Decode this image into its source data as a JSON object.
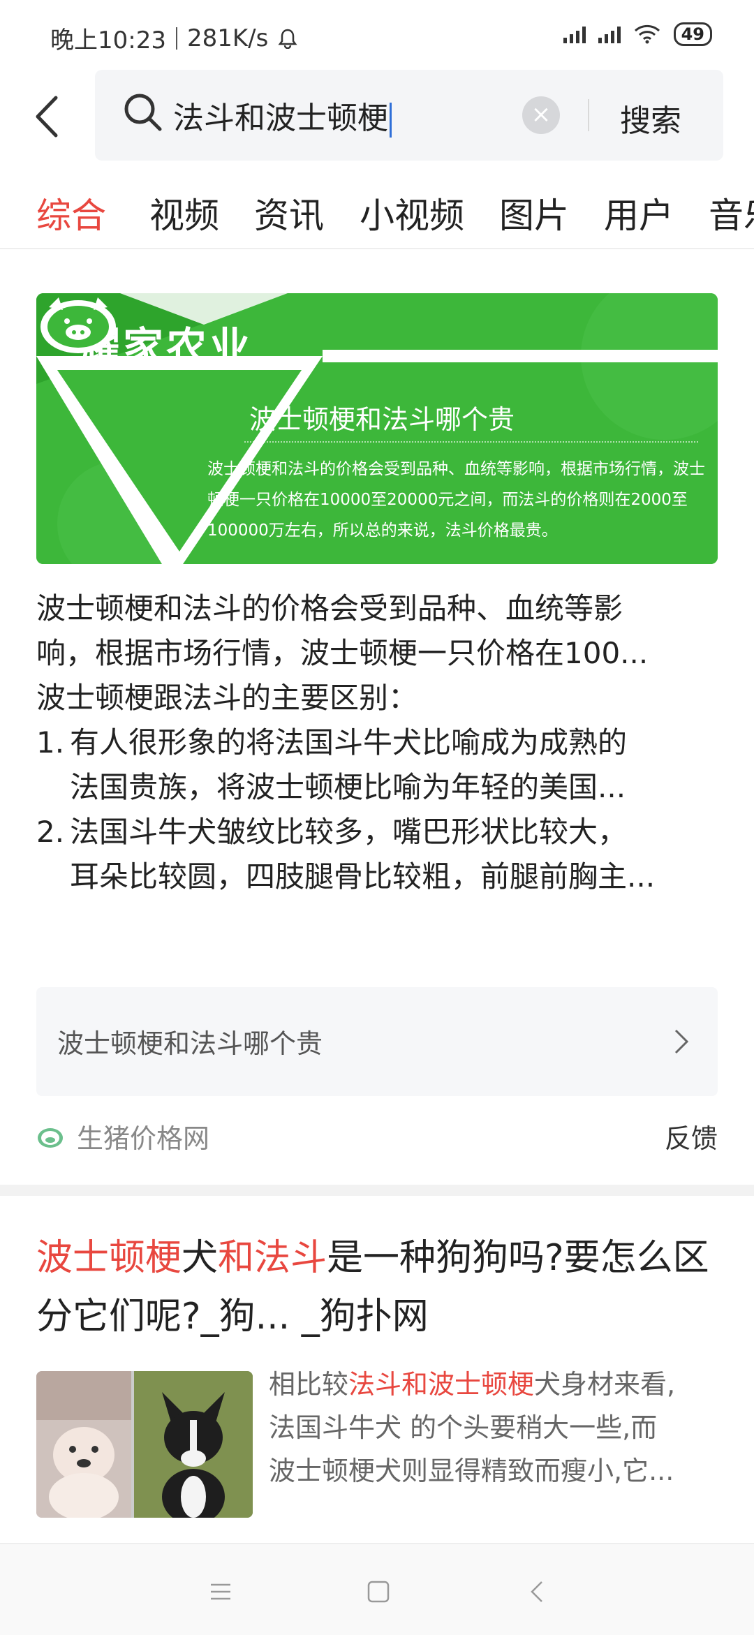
{
  "status_bar": {
    "time": "晚上10:23",
    "speed": "281K/s",
    "battery": "49",
    "icons": [
      "bell-icon",
      "signal-icon",
      "signal-icon",
      "wifi-icon",
      "battery-icon"
    ]
  },
  "search": {
    "query": "法斗和波士顿梗",
    "submit_label": "搜索",
    "clear_symbol": "×"
  },
  "tabs": [
    {
      "label": "综合",
      "active": true
    },
    {
      "label": "视频",
      "active": false
    },
    {
      "label": "资讯",
      "active": false
    },
    {
      "label": "小视频",
      "active": false
    },
    {
      "label": "图片",
      "active": false
    },
    {
      "label": "用户",
      "active": false
    },
    {
      "label": "音乐",
      "active": false
    }
  ],
  "card1": {
    "banner": {
      "brand": "耀家农业",
      "title": "波士顿梗和法斗哪个贵",
      "body": "波士顿梗和法斗的价格会受到品种、血统等影响，根据市场行情，波士顿梗一只价格在10000至20000元之间，而法斗的价格则在2000至100000万左右，所以总的来说，法斗价格最贵。"
    },
    "summary_lines": [
      "波士顿梗和法斗的价格会受到品种、血统等影",
      "响，根据市场行情，波士顿梗一只价格在100..."
    ],
    "subheading": "波士顿梗跟法斗的主要区别：",
    "points": [
      {
        "num": "1.",
        "line1": "有人很形象的将法国斗牛犬比喻成为成熟的",
        "line2": "法国贵族，将波士顿梗比喻为年轻的美国..."
      },
      {
        "num": "2.",
        "line1": "法国斗牛犬皱纹比较多，嘴巴形状比较大，",
        "line2": "耳朵比较圆，四肢腿骨比较粗，前腿前胸主..."
      }
    ],
    "related_query": "波士顿梗和法斗哪个贵",
    "source": "生猪价格网",
    "feedback": "反馈"
  },
  "card2": {
    "title_parts": [
      {
        "text": "波士顿梗",
        "hl": true
      },
      {
        "text": "犬",
        "hl": false
      },
      {
        "text": "和法斗",
        "hl": true
      },
      {
        "text": "是一种狗狗吗?要怎么区分它们呢?_狗... _狗扑网",
        "hl": false
      }
    ],
    "snippet": {
      "line1_pre": "相比较",
      "line1_hl": "法斗和波士顿梗",
      "line1_post": "犬身材来看,",
      "line2": "法国斗牛犬 的个头要稍大一些,而",
      "line3": "波士顿梗犬则显得精致而瘦小,它..."
    }
  },
  "colors": {
    "accent": "#e8473f",
    "banner_green": "#3db73a",
    "caret": "#2f6fd8"
  }
}
